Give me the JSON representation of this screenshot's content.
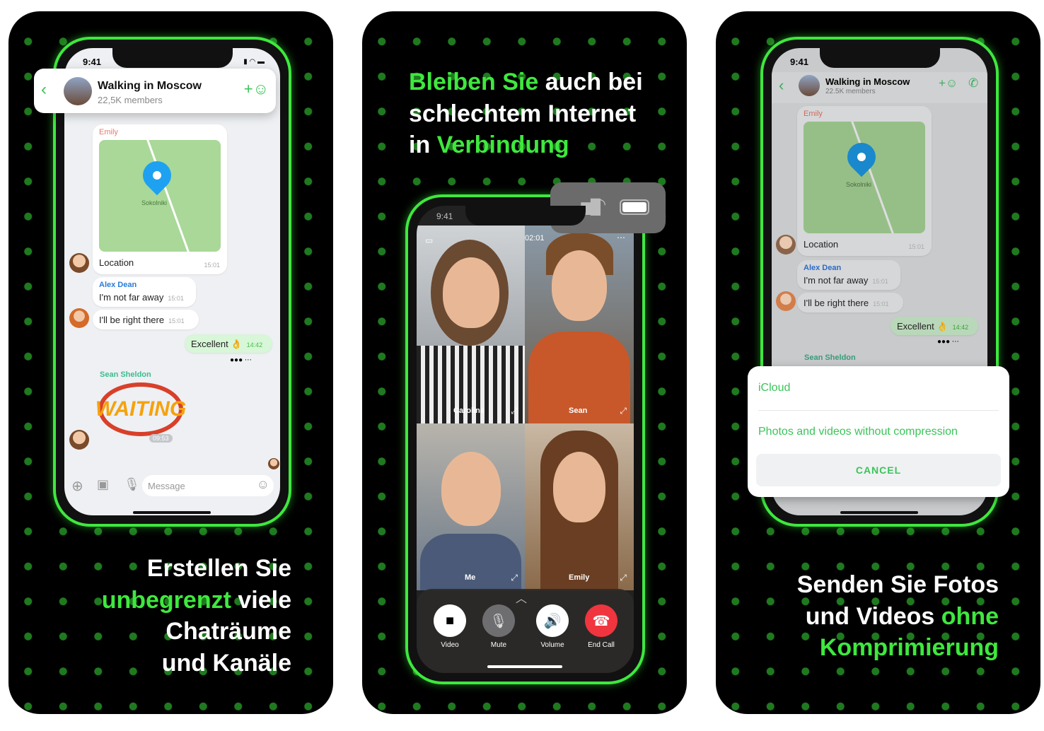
{
  "colors": {
    "accent": "#3ee83e",
    "background": "#000000",
    "end_call": "#f0353f",
    "pin": "#1ea1f1"
  },
  "panel1": {
    "caption": {
      "l1": "Erstellen Sie",
      "l2a": "unbegrenzt",
      "l2b": " viele",
      "l3": "Chaträume",
      "l4": "und Kanäle"
    },
    "status_time": "9:41",
    "header": {
      "title": "Walking in Moscow",
      "subtitle": "22,5K members",
      "back_icon": "chevron-left-icon",
      "add_icon": "add-user-icon"
    },
    "messages": {
      "emily_name": "Emily",
      "map_label": "Sokolniki",
      "location": "Location",
      "location_time": "15:01",
      "alex_name": "Alex Dean",
      "alex_msg1": "I'm not far away",
      "alex_time1": "15:01",
      "alex_msg2": "I'll be right there",
      "alex_time2": "15:01",
      "own_msg": "Excellent 👌",
      "own_time": "14:42",
      "sean_name": "Sean Sheldon",
      "sticker": "WAITING",
      "sticker_time": "09:53"
    },
    "input": {
      "placeholder": "Message"
    }
  },
  "panel2": {
    "caption": {
      "l1a": "Bleiben Sie",
      "l1b": " auch bei",
      "l2": "schlechtem Internet",
      "l3a": "in ",
      "l3b": "Verbindung"
    },
    "status_time": "9:41",
    "call_timer": "02:01",
    "participants": [
      "Caroline",
      "Sean",
      "Me",
      "Emily"
    ],
    "controls": [
      {
        "label": "Video",
        "icon": "video-camera-icon"
      },
      {
        "label": "Mute",
        "icon": "mic-off-icon"
      },
      {
        "label": "Volume",
        "icon": "speaker-icon"
      },
      {
        "label": "End Call",
        "icon": "hang-up-icon"
      }
    ]
  },
  "panel3": {
    "caption": {
      "l1": "Senden Sie Fotos",
      "l2a": "und Videos ",
      "l2b": "ohne",
      "l3": "Komprimierung"
    },
    "status_time": "9:41",
    "header": {
      "title": "Walking in Moscow",
      "subtitle": "22.5K members"
    },
    "messages": {
      "emily_name": "Emily",
      "map_label": "Sokolniki",
      "location": "Location",
      "location_time": "15:01",
      "alex_name": "Alex Dean",
      "alex_msg1": "I'm not far away",
      "alex_time1": "15:01",
      "alex_msg2": "I'll be right there",
      "alex_time2": "15:01",
      "own_msg": "Excellent 👌",
      "own_time": "14:42",
      "sean_name": "Sean Sheldon"
    },
    "sheet": {
      "option1": "iCloud",
      "option2": "Photos and videos without compression",
      "cancel": "CANCEL"
    }
  }
}
